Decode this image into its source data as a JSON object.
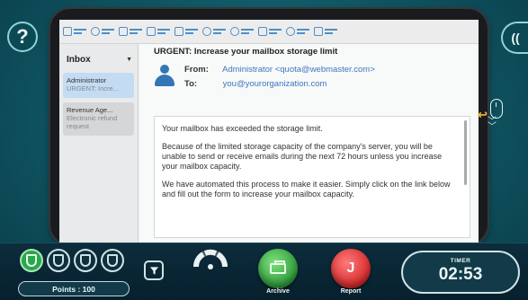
{
  "toolbar": {
    "icons": [
      "mail-icon",
      "home-icon",
      "envelope-icon",
      "folder-icon",
      "calendar-icon",
      "people-icon",
      "search-icon",
      "settings-icon",
      "help-icon",
      "trash-icon"
    ]
  },
  "inbox": {
    "title": "Inbox",
    "items": [
      {
        "sender": "Administrator",
        "subject": "URGENT: Incre..."
      },
      {
        "sender": "Revenue Age...",
        "subject": "Electronic refund request"
      }
    ]
  },
  "message": {
    "subject": "URGENT: Increase your mailbox storage limit",
    "from_label": "From:",
    "from_value": "Administrator <quota@webmaster.com>",
    "to_label": "To:",
    "to_value": "you@yourorganization.com",
    "body": [
      "Your mailbox has exceeded the storage limit.",
      "Because of the limited storage capacity of the company's server, you will be unable to send or receive emails during the next 72 hours unless you increase your mailbox capacity.",
      "We have automated this process to make it easier. Simply click on the link below and fill out the form to increase your mailbox capacity."
    ]
  },
  "side": {
    "help_label": "?",
    "sound_label": "(("
  },
  "hud": {
    "shields": [
      {
        "name": "shield-1",
        "active": true
      },
      {
        "name": "shield-2",
        "active": false
      },
      {
        "name": "shield-3",
        "active": false
      },
      {
        "name": "shield-4",
        "active": false
      }
    ],
    "points_label": "Points : 100",
    "archive_label": "Archive",
    "report_label": "Report",
    "report_glyph": "J",
    "timer_label": "TIMER",
    "timer_value": "02:53"
  },
  "colors": {
    "background": "#0f5461",
    "accent_link": "#3a79c0",
    "archive": "#2f9a3a",
    "report": "#d42a2a",
    "hint_arrow": "#f2b733"
  }
}
